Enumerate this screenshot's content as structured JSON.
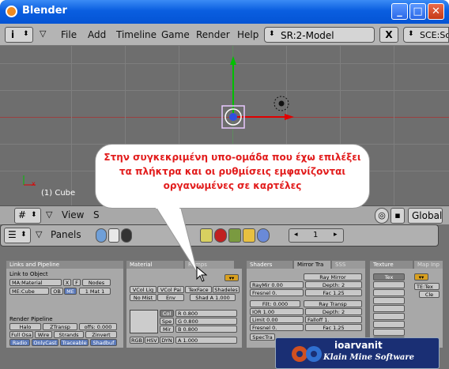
{
  "window": {
    "title": "Blender",
    "min_glyph": "_",
    "max_glyph": "□",
    "close_glyph": "✕"
  },
  "menubar": {
    "info_glyph": "i",
    "items": [
      "File",
      "Add",
      "Timeline",
      "Game",
      "Render",
      "Help"
    ],
    "scene_select": "SR:2-Model",
    "close_x": "X",
    "scene_short": "SCE:Sc"
  },
  "viewport": {
    "object_label": "(1) Cube",
    "axis_x": "x"
  },
  "callout": {
    "text": "Στην συγκεκριμένη υπο-ομάδα που έχω επιλέξει τα πλήκτρα και οι ρυθμίσεις εμφανίζονται οργανωμένες σε καρτέλες"
  },
  "view_header": {
    "view_label": "View",
    "s_label": "S",
    "global_label": "Global"
  },
  "buttons_header": {
    "panels_label": "Panels",
    "frame": "1",
    "arrow_left": "◂",
    "arrow_right": "▸"
  },
  "links_panel": {
    "title": "Links and Pipeline",
    "link_to_object": "Link to Object",
    "ma_field": "MA:Material",
    "x_btn": "X",
    "f_btn": "F",
    "nodes": "Nodes",
    "me_field": "ME:Cube",
    "ob_btn": "OB",
    "me_btn": "ME",
    "mat_count": "1 Mat 1",
    "render_pipeline": "Render Pipeline",
    "halo": "Halo",
    "ztransp": "ZTransp",
    "offs": "offs: 0.000",
    "full_osa": "Full Osa",
    "wire": "Wire",
    "strands": "Strands",
    "zinvert": "Zinvert",
    "radio": "Radio",
    "only_cast": "OnlyCast",
    "traceable": "Traceable",
    "shadbuf": "Shadbuf"
  },
  "material_panel": {
    "tab_material": "Material",
    "tab_ramps": "Ramps",
    "vcol_light": "VCol Lig",
    "vcol_paint": "VCol Pai",
    "texface": "TexFace",
    "shadeless": "Shadeles",
    "no_mist": "No Mist",
    "env": "Env",
    "shad_a": "Shad A 1.000",
    "col": "Col",
    "spe": "Spe",
    "mir": "Mir",
    "r_val": "R 0.800",
    "g_val": "G 0.800",
    "b_val": "B 0.800",
    "rgb": "RGB",
    "hsv": "HSV",
    "dyn": "DYN",
    "a_val": "A 1.000"
  },
  "shaders_panel": {
    "tab_shaders": "Shaders",
    "tab_mirror": "Mirror Tra",
    "tab_sss": "SSS",
    "ray_mirror": "Ray Mirror",
    "raymir": "RayMir 0.00",
    "depth_mirror": "Depth: 2",
    "fresnel": "Fresnel 0.",
    "fac1": "Fac 1.25",
    "filt": "Filt: 0.000",
    "ray_transp": "Ray Transp",
    "ior": "IOR 1.00",
    "depth_transp": "Depth: 2",
    "limit": "Limit 0.00",
    "falloff": "Falloff 1.",
    "fresnel2": "Fresnel 0.",
    "fac2": "Fac 1.25",
    "spectra": "SpecTra"
  },
  "texture_panel": {
    "tab_texture": "Texture",
    "tab_mapinput": "Map Inp",
    "tex": "Tex",
    "te_tex": "TE:Tex",
    "clear": "Cle"
  },
  "logo": {
    "name": "ioarvanit",
    "tagline": "Klain Mine Software"
  },
  "colors": {
    "title_blue": "#0a5ee0",
    "callout_red": "#e21c1c",
    "axis_green": "#00c000",
    "axis_red": "#e00000"
  }
}
